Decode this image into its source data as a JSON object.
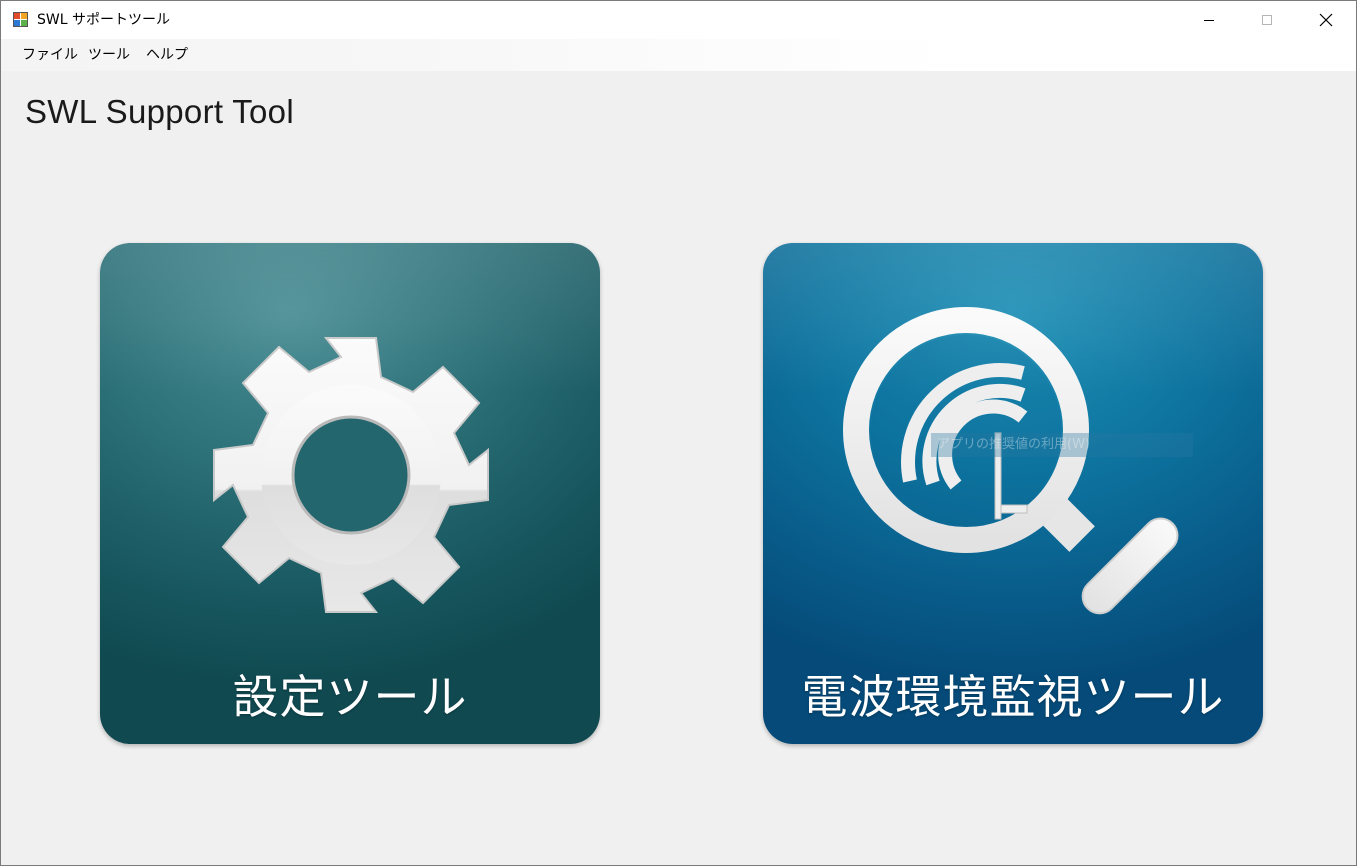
{
  "window": {
    "title": "SWL サポートツール",
    "controls": {
      "minimize": "minimize",
      "maximize": "maximize",
      "close": "close"
    }
  },
  "menu": {
    "items": [
      {
        "label": "ファイル"
      },
      {
        "label": "ツール"
      },
      {
        "label": "ヘルプ"
      }
    ]
  },
  "main": {
    "heading": "SWL Support Tool",
    "tiles": [
      {
        "label": "設定ツール",
        "icon": "gear-icon",
        "color": "#1b5f67"
      },
      {
        "label": "電波環境監視ツール",
        "icon": "radio-search-icon",
        "color": "#0a6694"
      }
    ],
    "faint_overlay_text": "アプリの推奨値の利用(W)"
  },
  "colors": {
    "window_bg": "#f0f0f0",
    "tile_settings": "#1b5f67",
    "tile_monitor": "#0a6694",
    "icon_fill": "#ebebeb"
  }
}
